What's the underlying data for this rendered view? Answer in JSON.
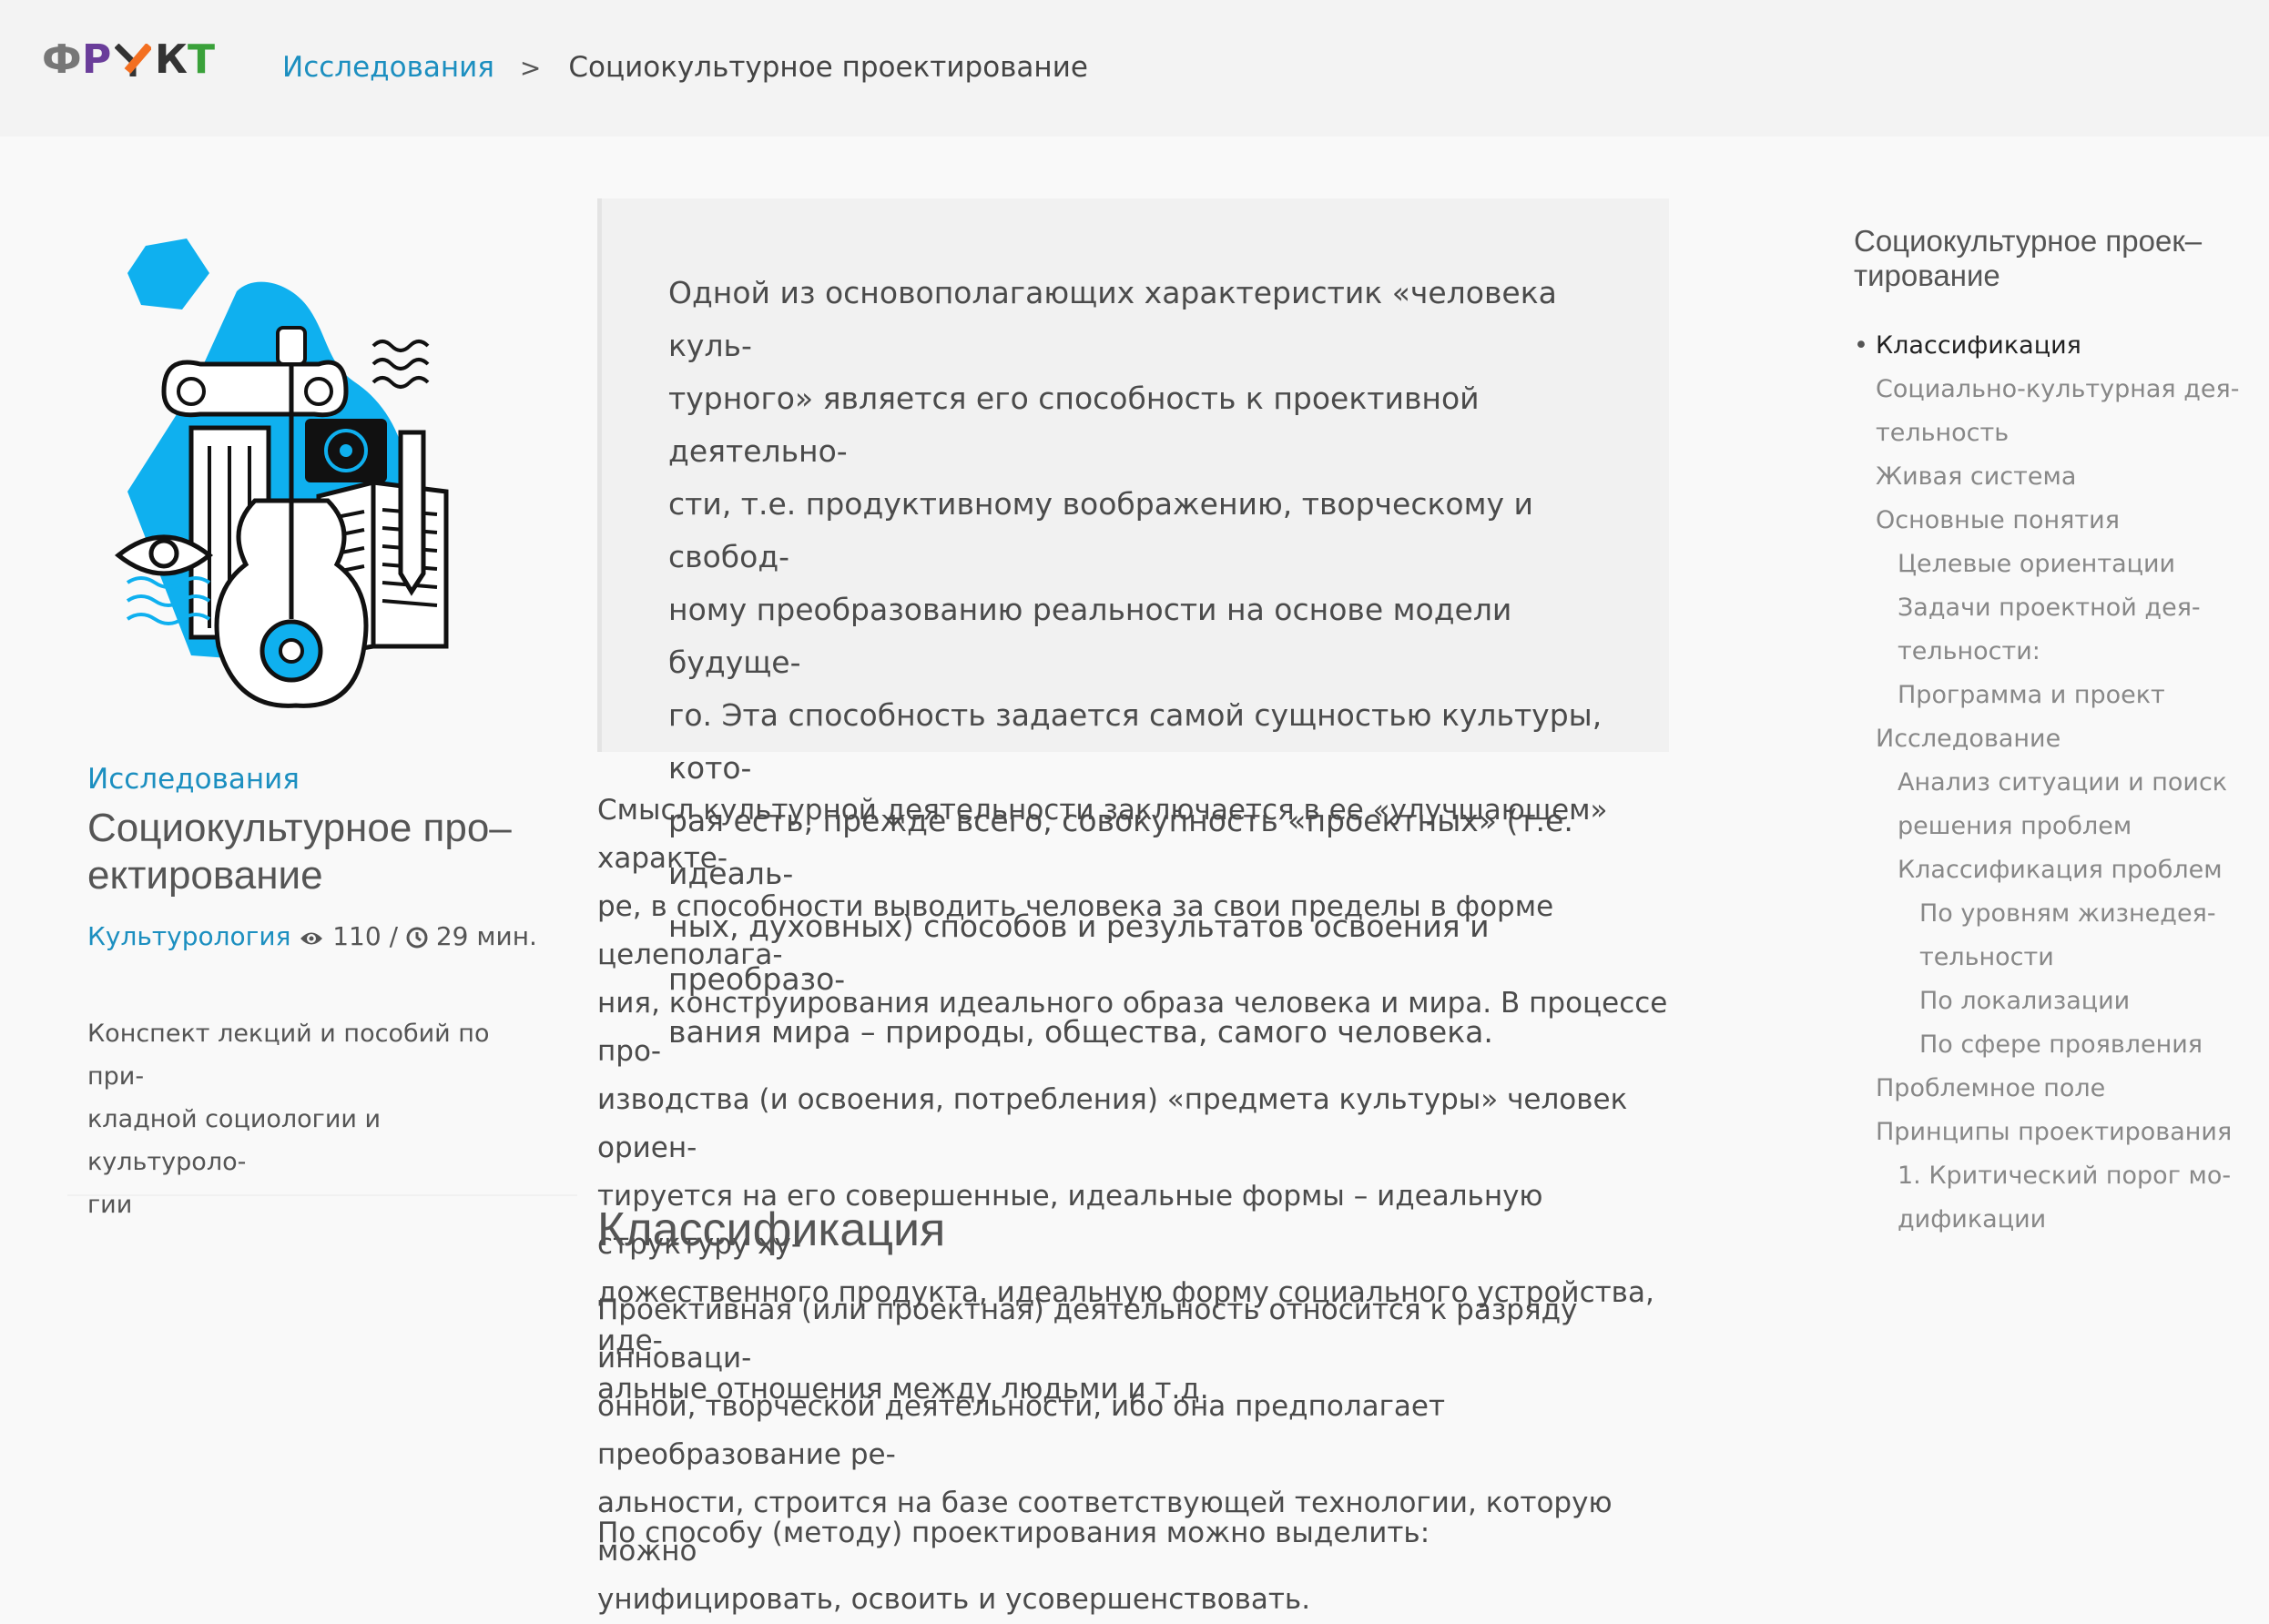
{
  "header": {
    "logo": [
      "Ф",
      "Р",
      "У",
      "К",
      "Т"
    ],
    "logo_colors": [
      "#777777",
      "#6a3d9a",
      "#555555",
      "#f36f21",
      "#333333",
      "#3aa13a"
    ],
    "breadcrumb": {
      "parent": "Исследования",
      "separator": ">",
      "current": "Социокультурное проектирование"
    }
  },
  "article": {
    "category": "Исследования",
    "title_line1": "Социокультурное про–",
    "title_line2": "ектирование",
    "tag": "Культурология",
    "views": "110",
    "read_time": "29 мин.",
    "meta_sep": "/",
    "description_lines": [
      "Конспект лекций и пособий по при-",
      "кладной социологии и культуроло-",
      "гии"
    ]
  },
  "quote_lines": [
    "Одной из основополагающих характеристик «человека куль-",
    "турного» является его способность к проективной деятельно-",
    "сти, т.е. продуктивному воображению, творческому и свобод-",
    "ному преобразованию реальности на основе модели будуще-",
    "го. Эта способность задается самой сущностью культуры, кото-",
    "рая есть, прежде всего, совокупность «проектных» (т.е. идеаль-",
    "ных, духовных) способов и результатов освоения и преобразо-",
    "вания мира – природы, общества, самого человека."
  ],
  "para1_lines": [
    "Смысл культурной деятельности заключается в ее «улучшающем» характе-",
    "ре, в способности выводить человека за свои пределы в форме целеполага-",
    "ния, конструирования идеального образа человека и мира. В процессе про-",
    "изводства (и освоения, потребления) «предмета культуры» человек ориен-",
    "тируется на его совершенные, идеальные формы – идеальную структуру ху-",
    "дожественного продукта, идеальную форму социального устройства, иде-",
    "альные отношения между людьми и т.д."
  ],
  "heading": "Классификация",
  "para2_lines": [
    "Проективная (или проектная) деятельность относится к разряду инноваци-",
    "онной, творческой деятельности, ибо она предполагает преобразование ре-",
    "альности, строится на базе соответствующей технологии, которую можно",
    "унифицировать, освоить и усовершенствовать."
  ],
  "para3": "По способу (методу) проектирования можно выделить:",
  "toc": {
    "title_line1": "Социокультурное проек–",
    "title_line2": "тирование",
    "items": [
      {
        "label": "Классификация",
        "level": 1,
        "active": true
      },
      {
        "label": "Социально-культурная дея-",
        "level": 1
      },
      {
        "label": "тельность",
        "level": 1
      },
      {
        "label": "Живая система",
        "level": 1
      },
      {
        "label": "Основные понятия",
        "level": 1
      },
      {
        "label": "Целевые ориентации",
        "level": 2
      },
      {
        "label": "Задачи проектной дея-",
        "level": 2
      },
      {
        "label": "тельности:",
        "level": 2
      },
      {
        "label": "Программа и проект",
        "level": 2
      },
      {
        "label": "Исследование",
        "level": 1
      },
      {
        "label": "Анализ ситуации и поиск",
        "level": 2
      },
      {
        "label": "решения проблем",
        "level": 2
      },
      {
        "label": "Классификация проблем",
        "level": 2
      },
      {
        "label": "По уровням жизнедея-",
        "level": 3
      },
      {
        "label": "тельности",
        "level": 3
      },
      {
        "label": "По локализации",
        "level": 3
      },
      {
        "label": "По сфере проявления",
        "level": 3
      },
      {
        "label": "Проблемное поле",
        "level": 1
      },
      {
        "label": "Принципы проектирования",
        "level": 1
      },
      {
        "label": "1. Критический порог мо-",
        "level": 2
      },
      {
        "label": "дификации",
        "level": 2
      }
    ]
  }
}
